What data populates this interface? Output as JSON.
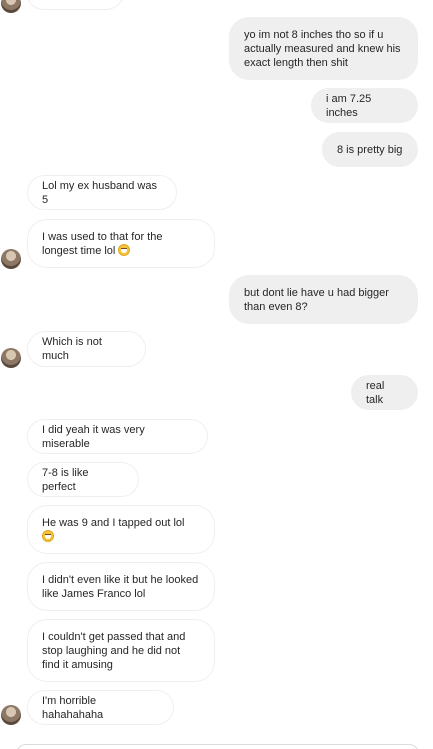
{
  "messages": [
    {
      "from": "me",
      "text": "yo im not 8 inches tho so if u actually measured and knew his exact length then shit"
    },
    {
      "from": "me",
      "text": "i am 7.25 inches"
    },
    {
      "from": "me",
      "text": "8 is pretty big"
    },
    {
      "from": "them",
      "text": "Lol my ex husband was 5"
    },
    {
      "from": "them",
      "text": "I was used to that for the longest time lol",
      "emoji": "grinning-sweat-emoji"
    },
    {
      "from": "me",
      "text": "but dont lie have u had bigger than even 8?"
    },
    {
      "from": "them",
      "text": "Which is not much"
    },
    {
      "from": "me",
      "text": "real talk"
    },
    {
      "from": "them",
      "text": "I did yeah it was very miserable"
    },
    {
      "from": "them",
      "text": "7-8 is like perfect"
    },
    {
      "from": "them",
      "text": "He was 9 and I tapped out lol",
      "emoji": "grinning-sweat-emoji"
    },
    {
      "from": "them",
      "text": "I didn't even like it but he looked like James Franco lol"
    },
    {
      "from": "them",
      "text": "I couldn't get passed that and stop laughing and he did not find it amusing"
    },
    {
      "from": "them",
      "text": "I'm horrible hahahahaha"
    }
  ],
  "colors": {
    "outgoing_bg": "#efefef",
    "incoming_border": "#efefef",
    "text": "#262626"
  }
}
